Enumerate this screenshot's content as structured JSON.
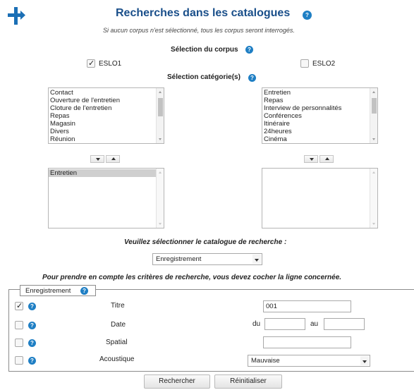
{
  "header": {
    "title": "Recherches dans les catalogues",
    "subtitle": "Si aucun corpus n'est sélectionné, tous les corpus seront interrogés."
  },
  "corpus": {
    "heading": "Sélection du corpus",
    "options": [
      {
        "label": "ESLO1",
        "checked": true
      },
      {
        "label": "ESLO2",
        "checked": false
      }
    ]
  },
  "categories": {
    "heading": "Sélection catégorie(s)",
    "left_available": [
      "Contact",
      "Ouverture de l'entretien",
      "Cloture de l'entretien",
      "Repas",
      "Magasin",
      "Divers",
      "Réunion"
    ],
    "left_selected": [
      "Entretien"
    ],
    "right_available": [
      "Entretien",
      "Repas",
      "Interview de personnalités",
      "Conférences",
      "Itinéraire",
      "24heures",
      "Cinéma"
    ],
    "right_selected": []
  },
  "catalogue": {
    "prompt": "Veuillez sélectionner le catalogue de recherche :",
    "selected": "Enregistrement",
    "note": "Pour prendre en compte les critères de recherche, vous devez cocher la ligne concernée."
  },
  "criteria": {
    "legend": "Enregistrement",
    "rows": [
      {
        "label": "Titre",
        "checked": true,
        "value": "001"
      },
      {
        "label": "Date",
        "checked": false,
        "from_label": "du",
        "from_value": "",
        "to_label": "au",
        "to_value": ""
      },
      {
        "label": "Spatial",
        "checked": false,
        "value": ""
      },
      {
        "label": "Acoustique",
        "checked": false,
        "selected": "Mauvaise"
      }
    ]
  },
  "actions": {
    "search": "Rechercher",
    "reset": "Réinitialiser"
  },
  "colors": {
    "title_blue": "#1a4f8a",
    "help_blue": "#1f7fc4",
    "logo_blue": "#1b6fb5"
  },
  "icons": {
    "logo": "plus-arrow-logo-icon",
    "help": "help-icon"
  }
}
